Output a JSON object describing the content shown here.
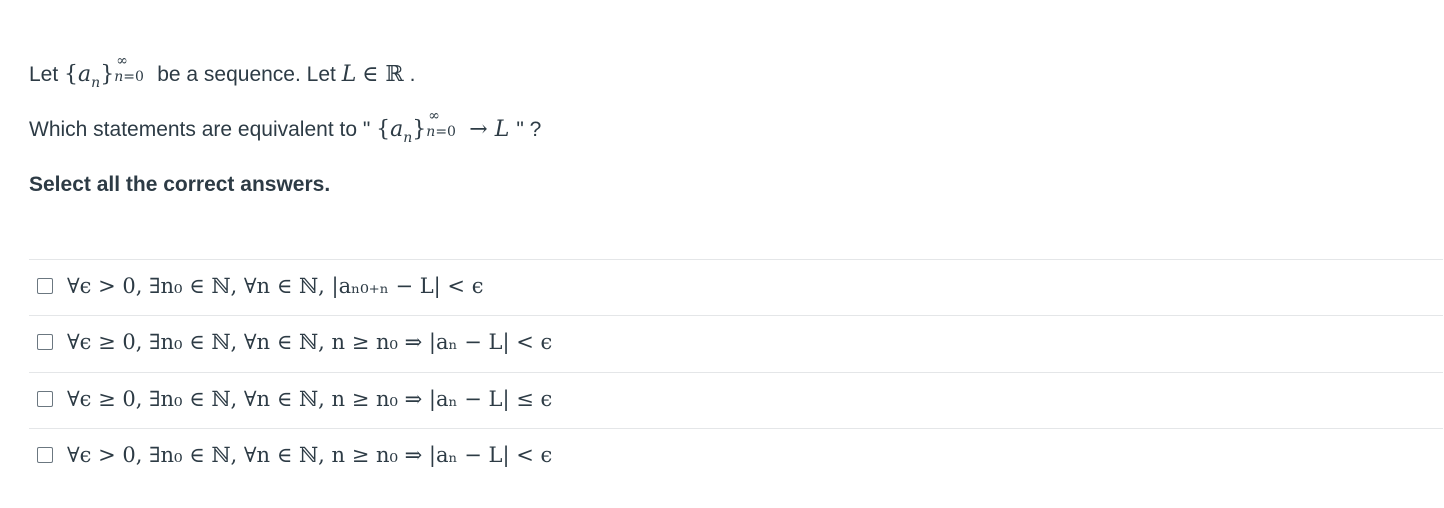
{
  "question": {
    "line1": {
      "prefix": "Let",
      "seq_open": "{",
      "seq_var": "a",
      "seq_sub": "n",
      "seq_close": "}",
      "seq_sup": "∞",
      "seq_lower": "n=0",
      "middle": "be a sequence. Let",
      "L": "L",
      "in_reals": "∈ ℝ",
      "end": "."
    },
    "line2": {
      "prefix": "Which statements are equivalent to \"",
      "seq_open": "{",
      "seq_var": "a",
      "seq_sub": "n",
      "seq_close": "}",
      "seq_sup": "∞",
      "seq_lower": "n=0",
      "arrow": "→",
      "L": "L",
      "suffix": "\" ?"
    },
    "instruction": "Select all the correct answers."
  },
  "answers": [
    {
      "text": "∀ϵ > 0, ∃n₀ ∈ ℕ, ∀n ∈ ℕ, |aₙ₀₊ₙ − L| < ϵ",
      "checked": false
    },
    {
      "text": "∀ϵ ≥ 0, ∃n₀ ∈ ℕ, ∀n ∈ ℕ, n ≥ n₀ ⇒ |aₙ − L| < ϵ",
      "checked": false
    },
    {
      "text": "∀ϵ ≥ 0, ∃n₀ ∈ ℕ, ∀n ∈ ℕ, n ≥ n₀ ⇒ |aₙ − L| ≤ ϵ",
      "checked": false
    },
    {
      "text": "∀ϵ > 0, ∃n₀ ∈ ℕ, ∀n ∈ ℕ, n ≥ n₀ ⇒ |aₙ − L| < ϵ",
      "checked": false
    }
  ]
}
